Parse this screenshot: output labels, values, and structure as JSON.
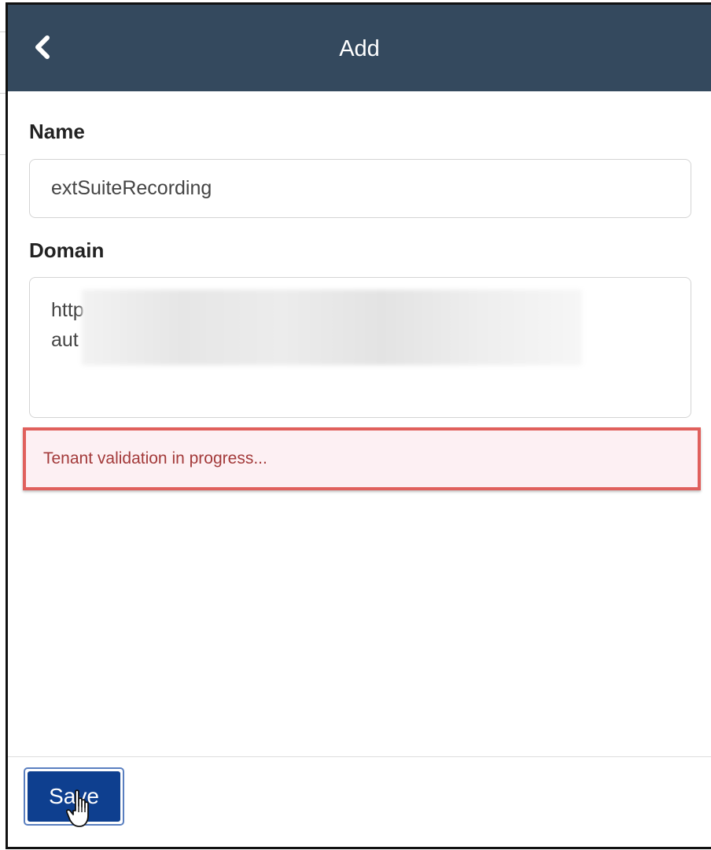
{
  "header": {
    "title": "Add",
    "back_icon": "chevron-left-icon",
    "background": "#34495e"
  },
  "form": {
    "name_label": "Name",
    "name_value": "extSuiteRecording",
    "domain_label": "Domain",
    "domain_line_1": "http",
    "domain_line_2": "aut",
    "domain_redacted": true
  },
  "alert": {
    "message": "Tenant validation in progress...",
    "border_color": "#e0605c",
    "background": "#fdf0f3",
    "text_color": "#a33a3a"
  },
  "footer": {
    "save_label": "Save",
    "save_color": "#0e3f8f"
  }
}
